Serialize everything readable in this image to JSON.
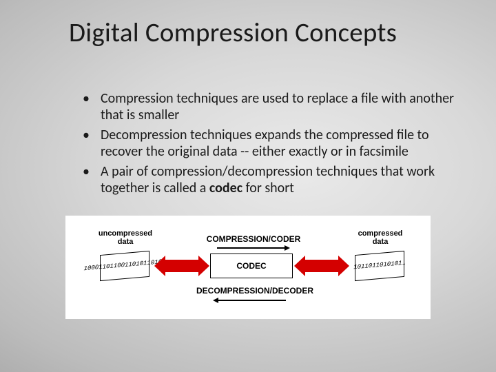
{
  "title": "Digital Compression Concepts",
  "bullets": [
    "Compression techniques are used to replace a file with another that is smaller",
    "Decompression techniques expands the compressed file to recover the original data -- either exactly or in facsimile",
    "A pair of compression/decompression techniques that work together is called a "
  ],
  "bullet3_bold": "codec",
  "bullet3_tail": " for short",
  "diagram": {
    "uncompressed_label": "uncompressed data",
    "uncompressed_bits": "100011011001101011010…",
    "compressed_label": "compressed data",
    "compressed_bits": "1011011010101…",
    "top_label": "COMPRESSION/CODER",
    "center_label": "CODEC",
    "bottom_label": "DECOMPRESSION/DECODER"
  }
}
